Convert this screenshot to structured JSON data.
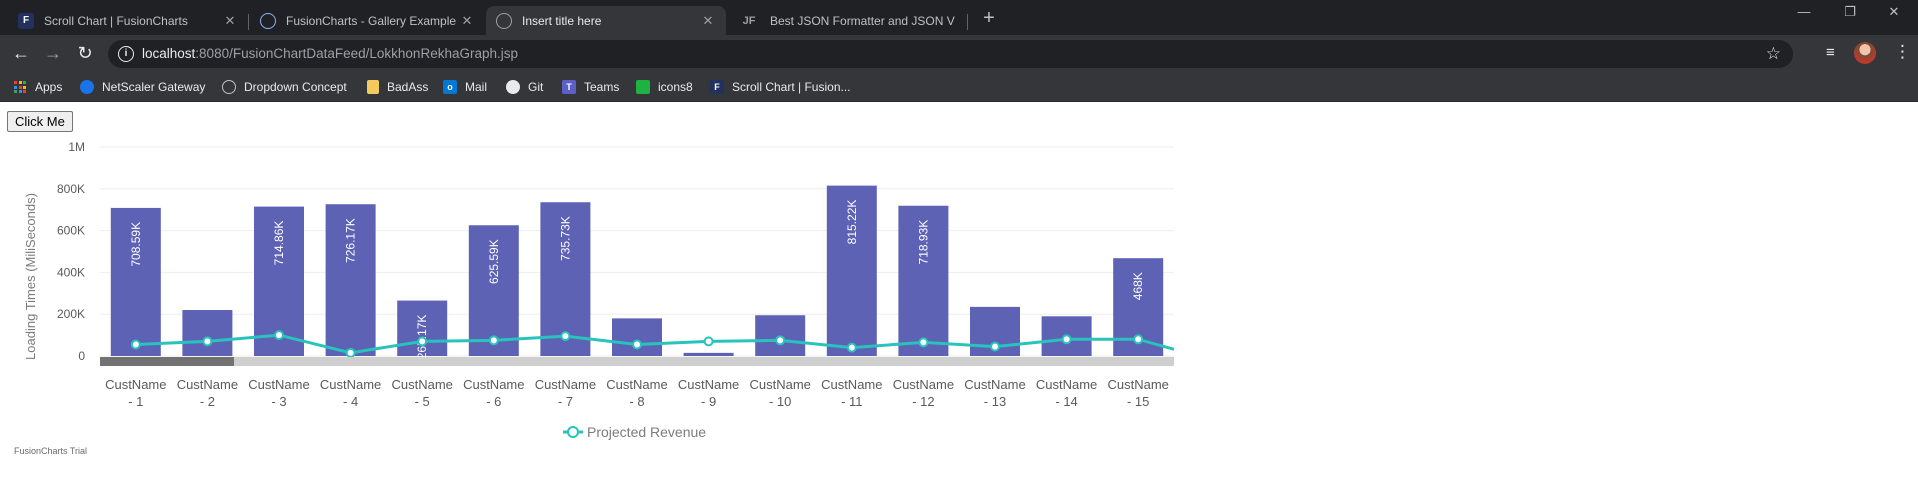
{
  "tabs": [
    {
      "title": "Scroll Chart | FusionCharts",
      "close": "✕",
      "favicon": "fusioncharts-icon"
    },
    {
      "title": "FusionCharts - Gallery Example -",
      "close": "✕",
      "favicon": "gallery-icon"
    },
    {
      "title": "Insert title here",
      "close": "✕",
      "favicon": "globe-icon"
    },
    {
      "title": "Best JSON Formatter and JSON V",
      "close": "",
      "favicon": "jf-icon",
      "favicon_text": "JF"
    }
  ],
  "new_tab": "+",
  "window_controls": {
    "minimize": "—",
    "restore": "❐",
    "close": "✕"
  },
  "nav": {
    "back": "←",
    "forward": "→",
    "reload": "↻"
  },
  "omnibox": {
    "host": "localhost",
    "path": ":8080/FusionChartDataFeed/LokkhonRekhaGraph.jsp",
    "info": "i",
    "star": "☆"
  },
  "toolbar_right": {
    "media": "≡",
    "menu": "⋮"
  },
  "bookmarks": [
    {
      "label": "Apps",
      "icon": "apps-icon",
      "color": "#ea4335"
    },
    {
      "label": "NetScaler Gateway",
      "icon": "netscaler-icon",
      "color": "#1a73e8"
    },
    {
      "label": "Dropdown Concept",
      "icon": "globe-icon",
      "color": "#5f6368"
    },
    {
      "label": "BadAss",
      "icon": "folder-icon",
      "color": "#f4c95d"
    },
    {
      "label": "Mail",
      "icon": "outlook-icon",
      "color": "#0078d4",
      "icon_text": "o"
    },
    {
      "label": "Git",
      "icon": "github-icon",
      "color": "#24292e"
    },
    {
      "label": "Teams",
      "icon": "teams-icon",
      "color": "#5b5fc7",
      "icon_text": "T"
    },
    {
      "label": "icons8",
      "icon": "icons8-icon",
      "color": "#1fb141"
    },
    {
      "label": "Scroll Chart | Fusion...",
      "icon": "fusioncharts-icon",
      "color": "#24315e",
      "icon_text": "F"
    }
  ],
  "page": {
    "button_label": "Click Me",
    "trial_label": "FusionCharts Trial"
  },
  "colors": {
    "bar": "#5d62b5",
    "line": "#29c3be",
    "scroll_track": "#cfcfcf",
    "scroll_thumb": "#727272"
  },
  "chart_data": {
    "type": "bar",
    "ylabel": "Loading Times (MiliSeconds)",
    "ylim": [
      0,
      1000000
    ],
    "yticks": [
      "0",
      "200K",
      "400K",
      "600K",
      "800K",
      "1M"
    ],
    "categories": [
      "CustName - 1",
      "CustName - 2",
      "CustName - 3",
      "CustName - 4",
      "CustName - 5",
      "CustName - 6",
      "CustName - 7",
      "CustName - 8",
      "CustName - 9",
      "CustName - 10",
      "CustName - 11",
      "CustName - 12",
      "CustName - 13",
      "CustName - 14",
      "CustName - 15"
    ],
    "series": [
      {
        "values": [
          708590,
          220000,
          714860,
          726170,
          265170,
          625590,
          735730,
          180000,
          15000,
          195000,
          815220,
          718930,
          235000,
          190000,
          468000
        ],
        "labels": [
          "708.59K",
          "",
          "714.86K",
          "726.17K",
          "265.17K",
          "625.59K",
          "735.73K",
          "",
          "",
          "",
          "815.22K",
          "718.93K",
          "",
          "",
          "468K"
        ]
      },
      {
        "name": "Projected Revenue",
        "type": "line",
        "values": [
          55000,
          70000,
          100000,
          15000,
          70000,
          75000,
          95000,
          55000,
          70000,
          75000,
          40000,
          65000,
          45000,
          80000,
          80000
        ]
      }
    ],
    "legend": "bottom-center",
    "grid": true,
    "scrollbar": true
  }
}
